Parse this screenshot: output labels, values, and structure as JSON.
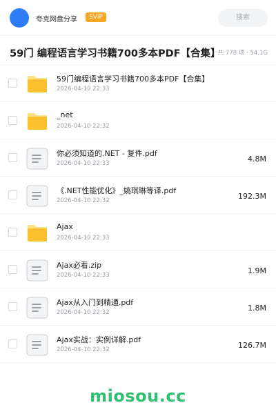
{
  "header": {
    "brand": "夸克网盘分享",
    "badge": "SVIP",
    "search_placeholder": "搜索",
    "accent": "#2f7df6"
  },
  "title": {
    "text": "59门 编程语言学习书籍700多本PDF【合集】",
    "meta": "共 778 项 · 54.1G"
  },
  "files": [
    {
      "type": "folder",
      "icon": "folder-icon",
      "name": "59门编程语言学习书籍700多本PDF【合集】",
      "date": "2026-04-10 22:33",
      "size": ""
    },
    {
      "type": "folder",
      "icon": "folder-icon",
      "name": "_net",
      "date": "2026-04-10 22:32",
      "size": ""
    },
    {
      "type": "file",
      "icon": "document-icon",
      "name": "你必须知道的.NET - 复件.pdf",
      "date": "2026-04-10 22:33",
      "size": "4.8M"
    },
    {
      "type": "file",
      "icon": "document-icon",
      "name": "《.NET性能优化》_姚琪琳等译.pdf",
      "date": "2026-04-10 22:32",
      "size": "192.3M"
    },
    {
      "type": "folder",
      "icon": "folder-icon",
      "name": "Ajax",
      "date": "2026-04-10 22:33",
      "size": ""
    },
    {
      "type": "file",
      "icon": "document-icon",
      "name": "Ajax必看.zip",
      "date": "2026-04-10 22:33",
      "size": "1.9M"
    },
    {
      "type": "file",
      "icon": "document-icon",
      "name": "Ajax从入门到精通.pdf",
      "date": "2026-04-10 22:32",
      "size": "1.8M"
    },
    {
      "type": "file",
      "icon": "document-icon",
      "name": "Ajax实战：实例详解.pdf",
      "date": "2026-04-10 22:32",
      "size": "126.7M"
    }
  ],
  "watermark": "miosou.cc",
  "colors": {
    "folder": "#fbc02d",
    "folder_tab": "#ffe082",
    "watermark": "#2fbf71",
    "badge": "#f5a623"
  }
}
